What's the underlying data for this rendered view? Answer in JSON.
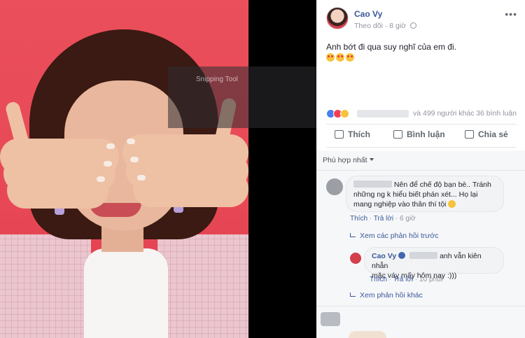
{
  "post": {
    "author": "Cao Vy",
    "follow": "Theo dõi",
    "time": "8 giờ",
    "text": "Anh bớt đi qua suy nghĩ của em đi.",
    "more": "•••"
  },
  "stats": {
    "reactions_others": "và 499 người khác",
    "comment_count": "36 bình luận"
  },
  "actions": {
    "like": "Thích",
    "comment": "Bình luận",
    "share": "Chia sẻ"
  },
  "comments": {
    "sort": "Phù hợp nhất",
    "first": {
      "line1": "Nên để chế độ bạn bè.. Tránh",
      "line2": "những ng k hiểu biết phán xét... Họ lại",
      "line3": "mang nghiệp vào thân thí tội",
      "like": "Thích",
      "reply": "Trả lời",
      "time": "6 giờ"
    },
    "prev_replies": "Xem các phản hồi trước",
    "reply": {
      "author": "Cao Vy",
      "line1": "anh vẫn kiên nhẫn",
      "line2": "mặc váy mấy hôm nay :)))",
      "like": "Thích",
      "reply": "Trả lời",
      "time": "10 phút"
    },
    "other_replies": "Xem phản hồi khác"
  },
  "watermark": "Snipping Tool",
  "colors": {
    "link": "#385898",
    "background": "#e84855"
  }
}
